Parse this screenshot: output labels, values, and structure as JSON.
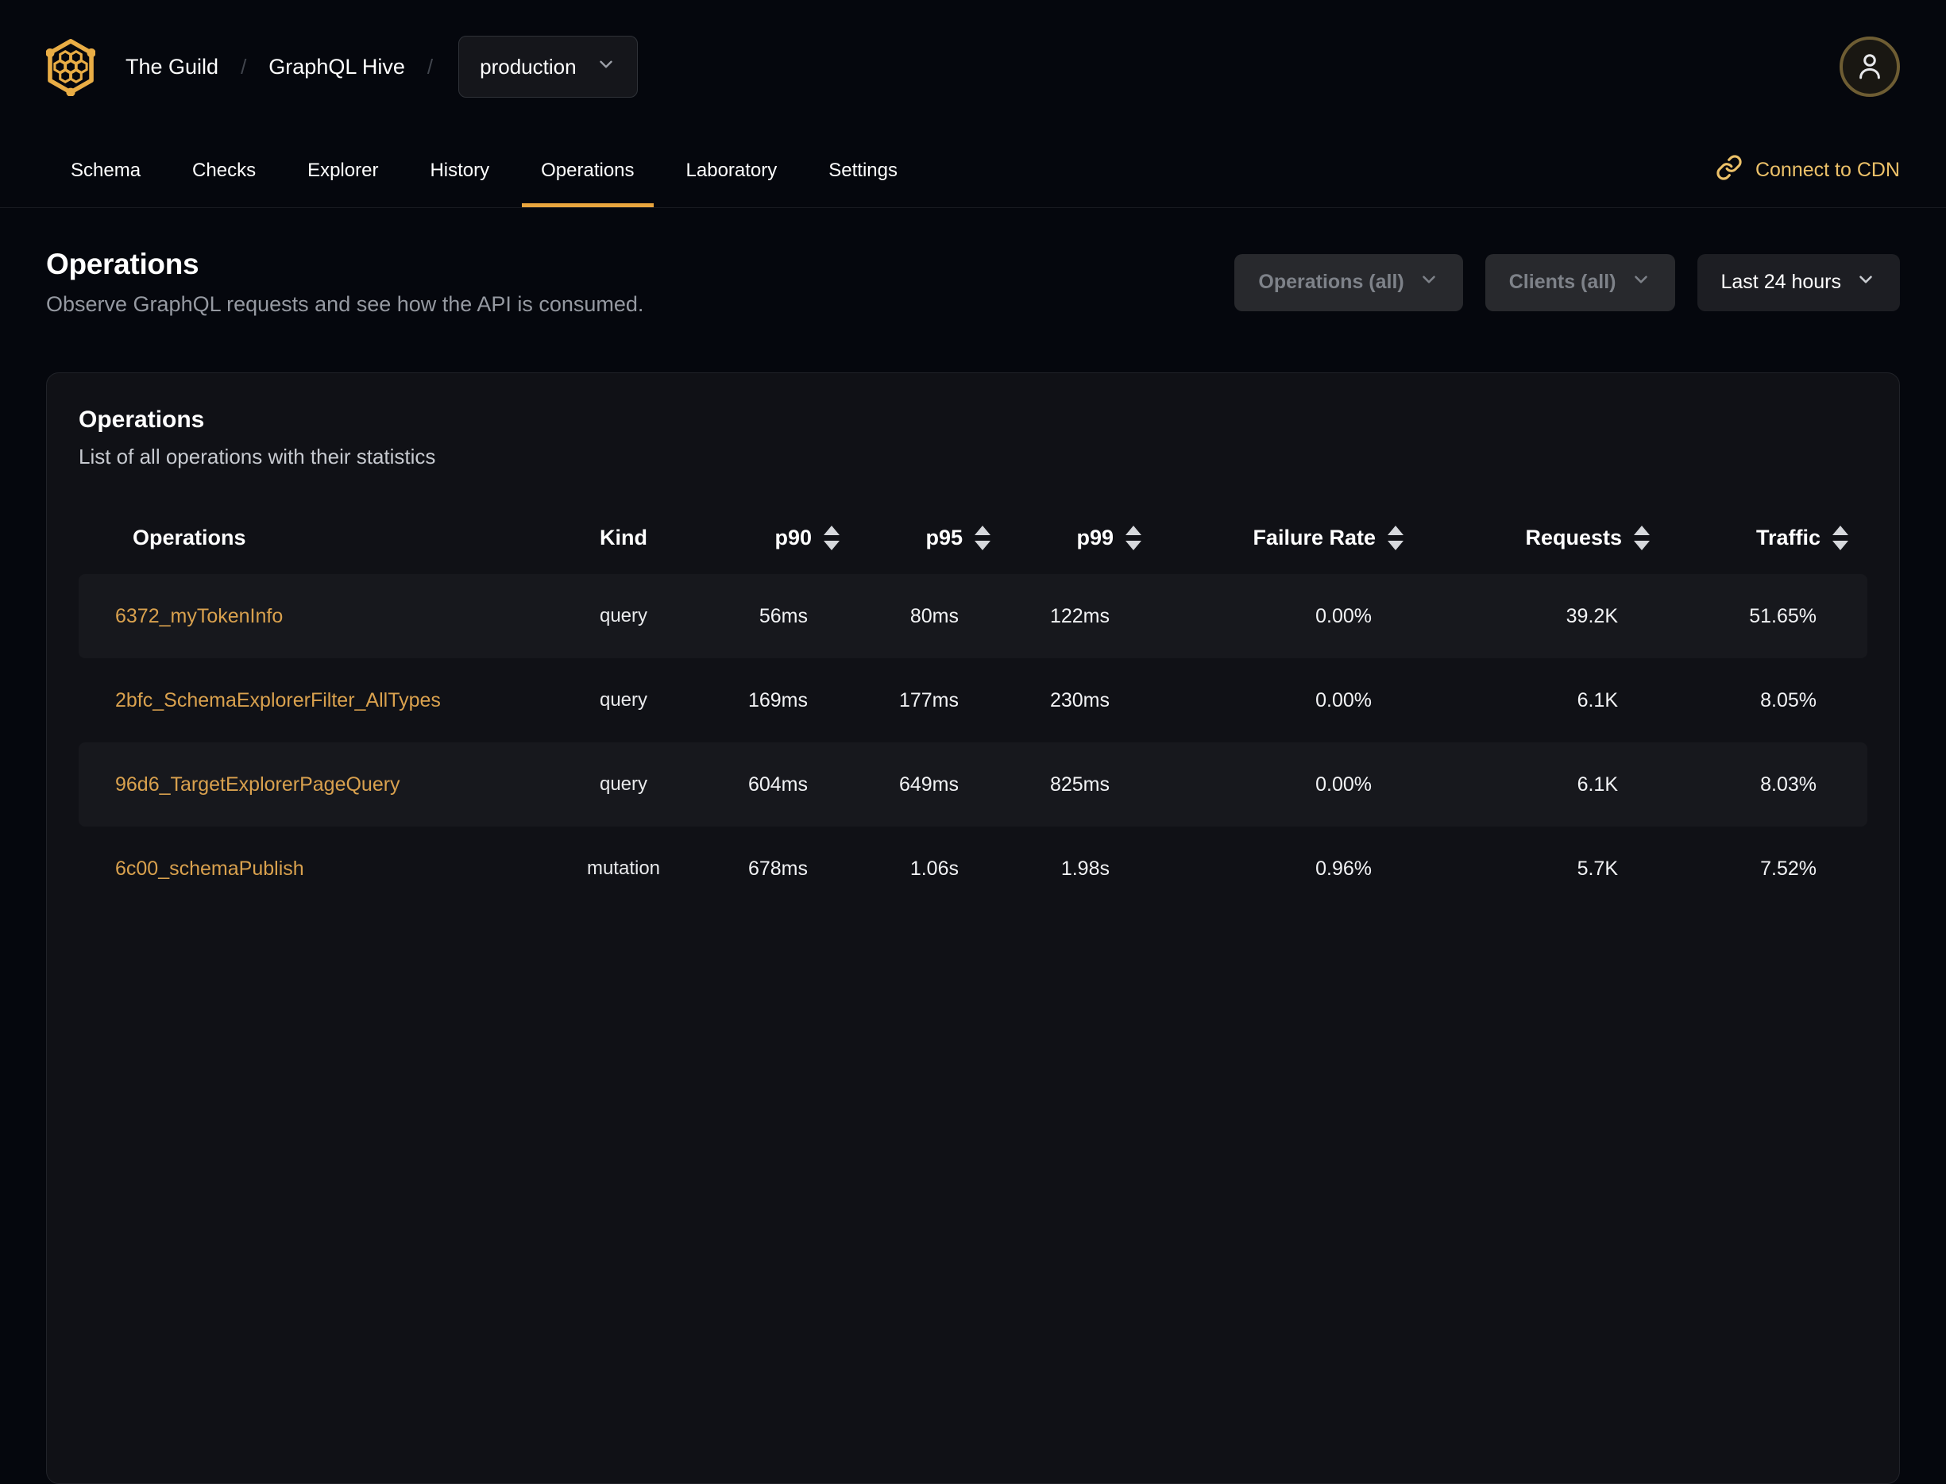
{
  "breadcrumb": {
    "org": "The Guild",
    "separator": "/",
    "project": "GraphQL Hive",
    "target": "production"
  },
  "nav": {
    "tabs": [
      {
        "label": "Schema",
        "active": false
      },
      {
        "label": "Checks",
        "active": false
      },
      {
        "label": "Explorer",
        "active": false
      },
      {
        "label": "History",
        "active": false
      },
      {
        "label": "Operations",
        "active": true
      },
      {
        "label": "Laboratory",
        "active": false
      },
      {
        "label": "Settings",
        "active": false
      }
    ],
    "cdn_link_label": "Connect to CDN"
  },
  "page": {
    "title": "Operations",
    "subtitle": "Observe GraphQL requests and see how the API is consumed.",
    "filters": [
      {
        "label": "Operations (all)",
        "muted": true
      },
      {
        "label": "Clients (all)",
        "muted": true
      },
      {
        "label": "Last 24 hours",
        "muted": false
      }
    ]
  },
  "card": {
    "title": "Operations",
    "subtitle": "List of all operations with their statistics",
    "table": {
      "columns": [
        {
          "key": "name",
          "label": "Operations",
          "align": "left",
          "sortable": false
        },
        {
          "key": "kind",
          "label": "Kind",
          "align": "center",
          "sortable": false
        },
        {
          "key": "p90",
          "label": "p90",
          "align": "right",
          "sortable": true
        },
        {
          "key": "p95",
          "label": "p95",
          "align": "right",
          "sortable": true
        },
        {
          "key": "p99",
          "label": "p99",
          "align": "right",
          "sortable": true
        },
        {
          "key": "failure_rate",
          "label": "Failure Rate",
          "align": "right",
          "sortable": true
        },
        {
          "key": "requests",
          "label": "Requests",
          "align": "right",
          "sortable": true
        },
        {
          "key": "traffic",
          "label": "Traffic",
          "align": "right",
          "sortable": true
        }
      ],
      "rows": [
        {
          "name": "6372_myTokenInfo",
          "kind": "query",
          "p90": "56ms",
          "p95": "80ms",
          "p99": "122ms",
          "failure_rate": "0.00%",
          "requests": "39.2K",
          "traffic": "51.65%"
        },
        {
          "name": "2bfc_SchemaExplorerFilter_AllTypes",
          "kind": "query",
          "p90": "169ms",
          "p95": "177ms",
          "p99": "230ms",
          "failure_rate": "0.00%",
          "requests": "6.1K",
          "traffic": "8.05%"
        },
        {
          "name": "96d6_TargetExplorerPageQuery",
          "kind": "query",
          "p90": "604ms",
          "p95": "649ms",
          "p99": "825ms",
          "failure_rate": "0.00%",
          "requests": "6.1K",
          "traffic": "8.03%"
        },
        {
          "name": "6c00_schemaPublish",
          "kind": "mutation",
          "p90": "678ms",
          "p95": "1.06s",
          "p99": "1.98s",
          "failure_rate": "0.96%",
          "requests": "5.7K",
          "traffic": "7.52%"
        }
      ]
    }
  },
  "icons": {
    "logo": "hive-honeycomb-logo",
    "dropdown": "chevron-down-icon",
    "cdn": "link-icon",
    "avatar": "user-icon",
    "sort": "sort-arrows-icon"
  },
  "colors": {
    "accent": "#e9a53e",
    "table_link": "#d9a14e",
    "cdn_link": "#ecc169",
    "page_bg": "#05070d",
    "card_bg": "#101116",
    "row_stripe": "#17181d"
  }
}
